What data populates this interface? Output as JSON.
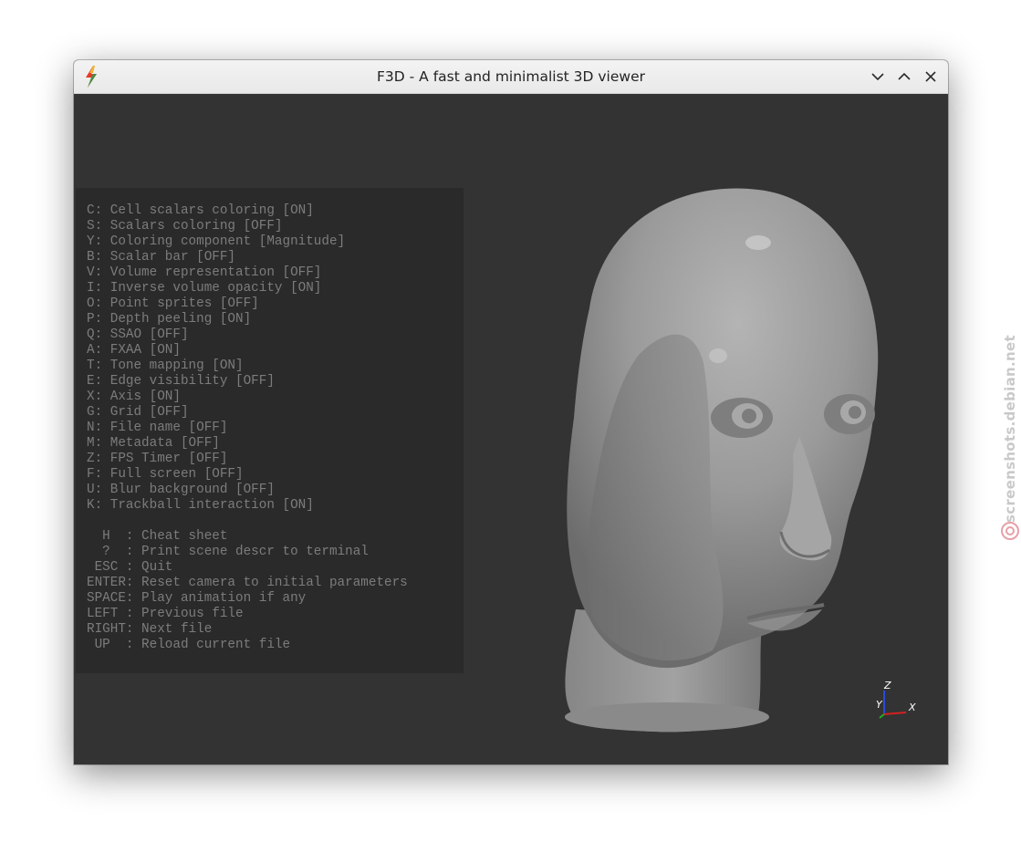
{
  "window": {
    "title": "F3D - A fast and minimalist 3D viewer",
    "icons": {
      "app": "f3d-lightning-icon",
      "minimize": "chevron-down-icon",
      "maximize": "chevron-up-icon",
      "close": "close-icon"
    }
  },
  "help": {
    "options": [
      "C: Cell scalars coloring [ON]",
      "S: Scalars coloring [OFF]",
      "Y: Coloring component [Magnitude]",
      "B: Scalar bar [OFF]",
      "V: Volume representation [OFF]",
      "I: Inverse volume opacity [ON]",
      "O: Point sprites [OFF]",
      "P: Depth peeling [ON]",
      "Q: SSAO [OFF]",
      "A: FXAA [ON]",
      "T: Tone mapping [ON]",
      "E: Edge visibility [OFF]",
      "X: Axis [ON]",
      "G: Grid [OFF]",
      "N: File name [OFF]",
      "M: Metadata [OFF]",
      "Z: FPS Timer [OFF]",
      "F: Full screen [OFF]",
      "U: Blur background [OFF]",
      "K: Trackball interaction [ON]"
    ],
    "keys": [
      "  H  : Cheat sheet",
      "  ?  : Print scene descr to terminal",
      " ESC : Quit",
      "ENTER: Reset camera to initial parameters",
      "SPACE: Play animation if any",
      "LEFT : Previous file",
      "RIGHT: Next file",
      " UP  : Reload current file"
    ]
  },
  "axes": {
    "x": "X",
    "y": "Y",
    "z": "Z"
  },
  "colors": {
    "viewport_bg": "#333333",
    "help_bg": "#2a2a2a",
    "help_text": "#7c7c7c",
    "model": "#9a9a9a",
    "axis_x": "#d62020",
    "axis_y": "#20b020",
    "axis_z": "#2a4ad8"
  },
  "watermark": {
    "text": "screenshots.debian.net"
  }
}
